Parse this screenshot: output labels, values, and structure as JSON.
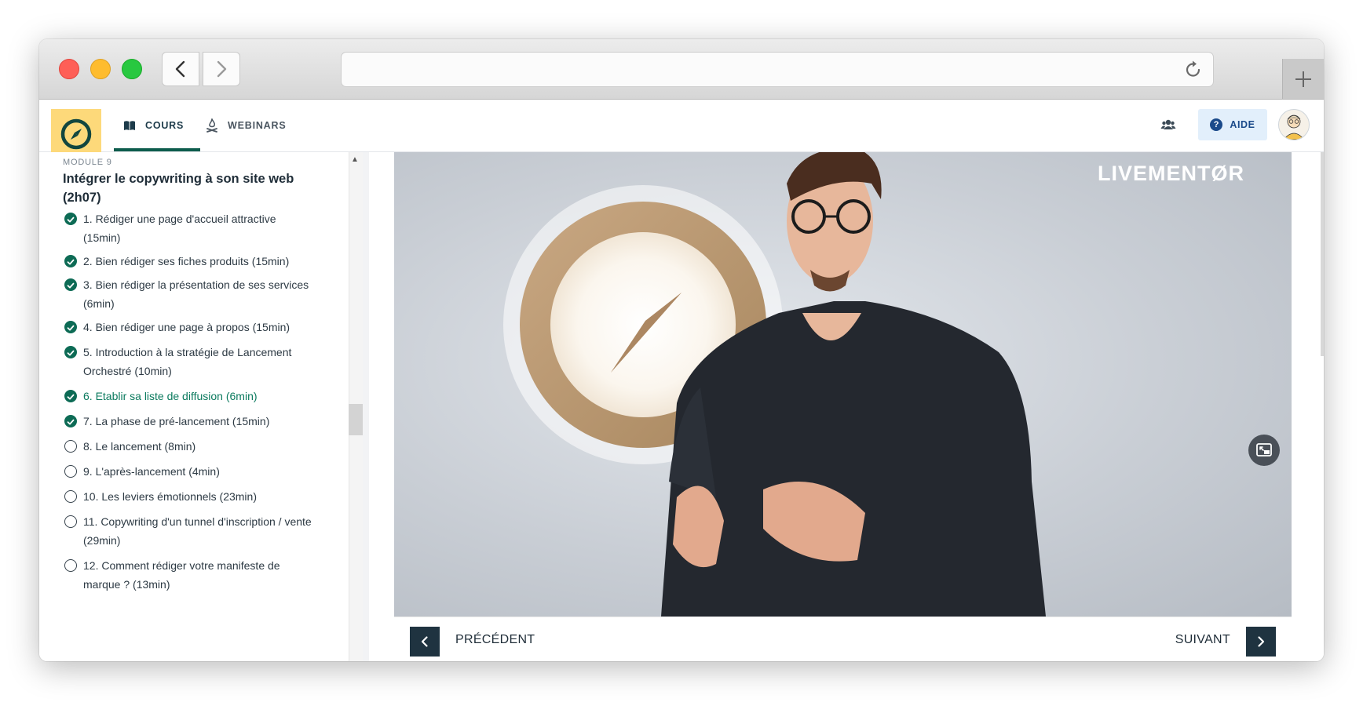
{
  "app": {
    "name": "LIVEMENTOR"
  },
  "header": {
    "tabs": [
      {
        "label": "COURS",
        "icon": "book-icon",
        "active": true
      },
      {
        "label": "WEBINARS",
        "icon": "campfire-icon",
        "active": false
      }
    ],
    "help_label": "AIDE"
  },
  "sidebar": {
    "module_label": "MODULE 9",
    "module_title": "Intégrer le copywriting à son site web (2h07)",
    "lessons": [
      {
        "label": "1. Rédiger une page d'accueil attractive (15min)",
        "done": true
      },
      {
        "label": "2. Bien rédiger ses fiches produits (15min)",
        "done": true
      },
      {
        "label": "3. Bien rédiger la présentation de ses services (6min)",
        "done": true
      },
      {
        "label": "4. Bien rédiger une page à propos (15min)",
        "done": true
      },
      {
        "label": "5. Introduction à la stratégie de Lancement Orchestré (10min)",
        "done": true
      },
      {
        "label": "6. Etablir sa liste de diffusion (6min)",
        "done": true,
        "current": true
      },
      {
        "label": "7. La phase de pré-lancement (15min)",
        "done": true
      },
      {
        "label": "8. Le lancement (8min)",
        "done": false
      },
      {
        "label": "9. L'après-lancement (4min)",
        "done": false
      },
      {
        "label": "10. Les leviers émotionnels (23min)",
        "done": false
      },
      {
        "label": "11. Copywriting d'un tunnel d'inscription / vente (29min)",
        "done": false
      },
      {
        "label": "12. Comment rédiger votre manifeste de marque ? (13min)",
        "done": false
      }
    ]
  },
  "video": {
    "brand_watermark": "LIVEMENTØR"
  },
  "lesson_nav": {
    "prev_label": "PRÉCÉDENT",
    "next_label": "SUIVANT"
  },
  "colors": {
    "accent": "#0d5c4c",
    "logo_bg": "#fdd97a",
    "nav_button": "#1f3340",
    "help_bg": "#e2effb"
  }
}
